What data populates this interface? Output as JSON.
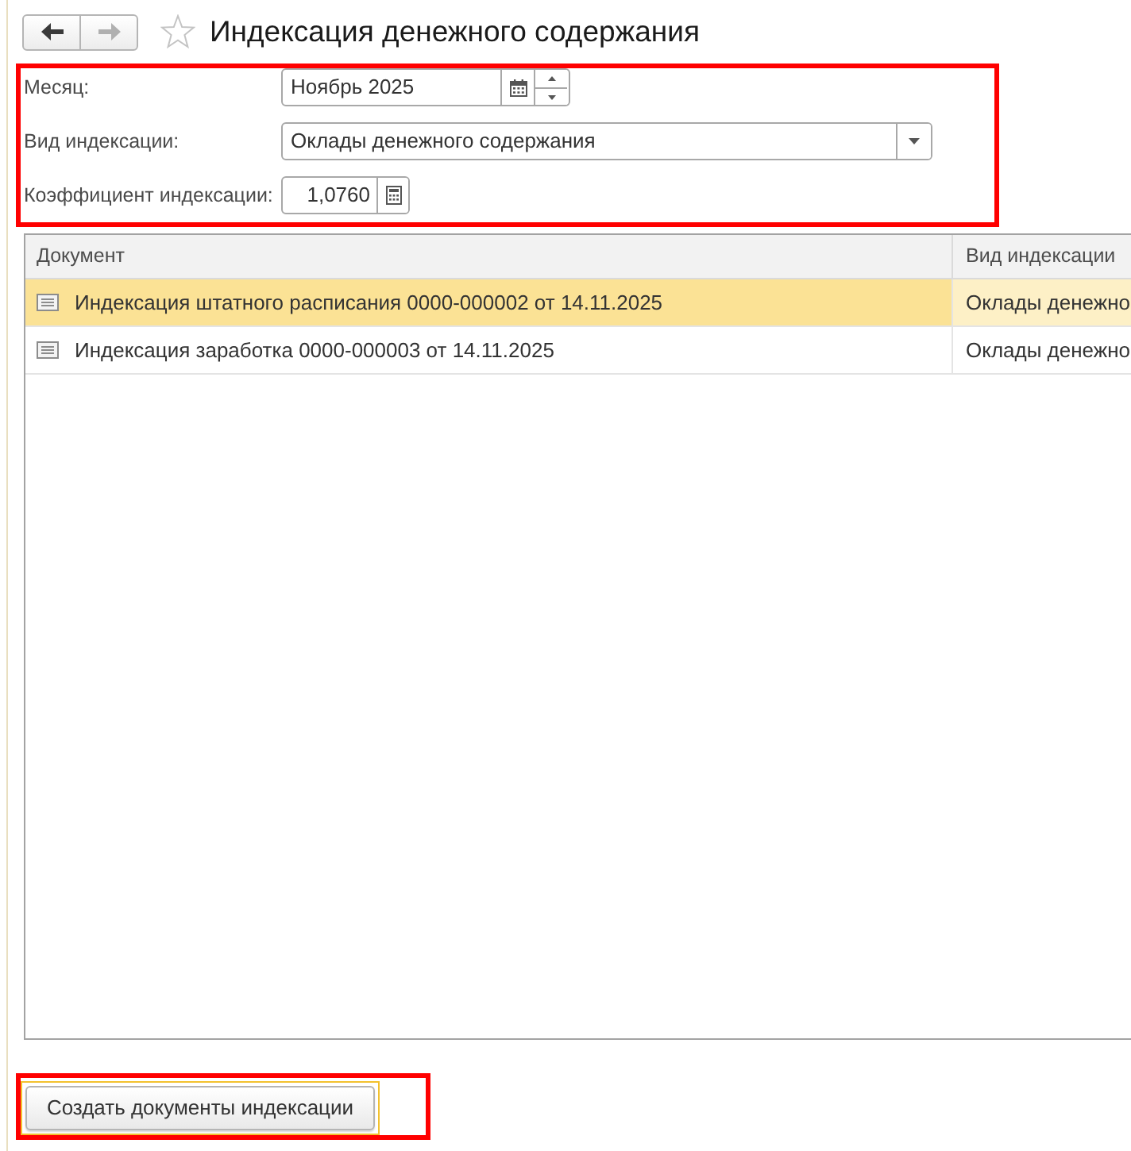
{
  "window": {
    "title": "Индексация денежного содержания",
    "favorite": false
  },
  "navigation": {
    "back": {
      "disabled": false
    },
    "forward": {
      "disabled": true
    }
  },
  "form": {
    "highlighted": true,
    "fields": [
      {
        "kind": "date",
        "label": "Месяц:",
        "value": "Ноябрь 2025"
      },
      {
        "kind": "select",
        "label": "Вид индексации:",
        "value": "Оклады денежного содержания"
      },
      {
        "kind": "number",
        "label": "Коэффициент индексации:",
        "value": "1,0760"
      }
    ]
  },
  "table": {
    "columns": [
      "Документ",
      "Вид индексации"
    ],
    "rows": [
      {
        "selected": true,
        "document": "Индексация штатного расписания 0000-000002 от 14.11.2025",
        "indexation_type": "Оклады денежно"
      },
      {
        "selected": false,
        "document": "Индексация заработка 0000-000003 от 14.11.2025",
        "indexation_type": "Оклады денежно"
      }
    ]
  },
  "footer": {
    "highlighted": true,
    "button": {
      "label": "Создать документы индексации",
      "focused": true
    }
  }
}
